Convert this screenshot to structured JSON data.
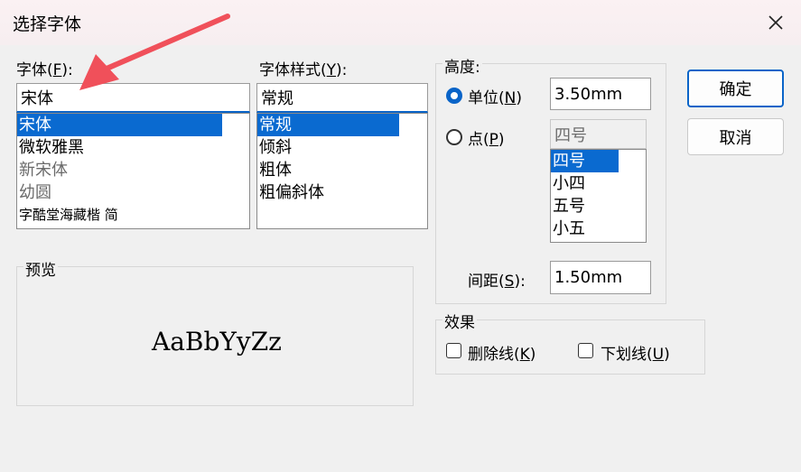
{
  "dialog": {
    "title": "选择字体"
  },
  "font": {
    "label_prefix": "字体(",
    "label_key": "F",
    "label_suffix": "):",
    "value": "宋体",
    "items": [
      "宋体",
      "微软雅黑",
      "新宋体",
      "幼圆",
      "字酷堂海藏楷 简"
    ],
    "selected_index": 0
  },
  "style": {
    "label_prefix": "字体样式(",
    "label_key": "Y",
    "label_suffix": "):",
    "value": "常规",
    "items": [
      "常规",
      "倾斜",
      "粗体",
      "粗偏斜体"
    ],
    "selected_index": 0
  },
  "height": {
    "group_label": "高度:",
    "unit_radio": {
      "prefix": "单位(",
      "key": "N",
      "suffix": ")",
      "value": "3.50mm",
      "checked": true
    },
    "point_radio": {
      "prefix": "点(",
      "key": "P",
      "suffix": ")",
      "value": "四号",
      "checked": false
    },
    "size_items": [
      "四号",
      "小四",
      "五号",
      "小五"
    ],
    "spacing": {
      "prefix": "间距(",
      "key": "S",
      "suffix": "):",
      "value": "1.50mm"
    }
  },
  "effects": {
    "group_label": "效果",
    "strike": {
      "prefix": "删除线(",
      "key": "K",
      "suffix": ")",
      "checked": false
    },
    "underline": {
      "prefix": "下划线(",
      "key": "U",
      "suffix": ")",
      "checked": false
    }
  },
  "preview": {
    "group_label": "预览",
    "sample": "AaBbYyZz"
  },
  "buttons": {
    "ok": "确定",
    "cancel": "取消"
  },
  "colors": {
    "accent": "#0a64c8",
    "selection": "#0a6ad0",
    "arrow": "#f0505a"
  }
}
